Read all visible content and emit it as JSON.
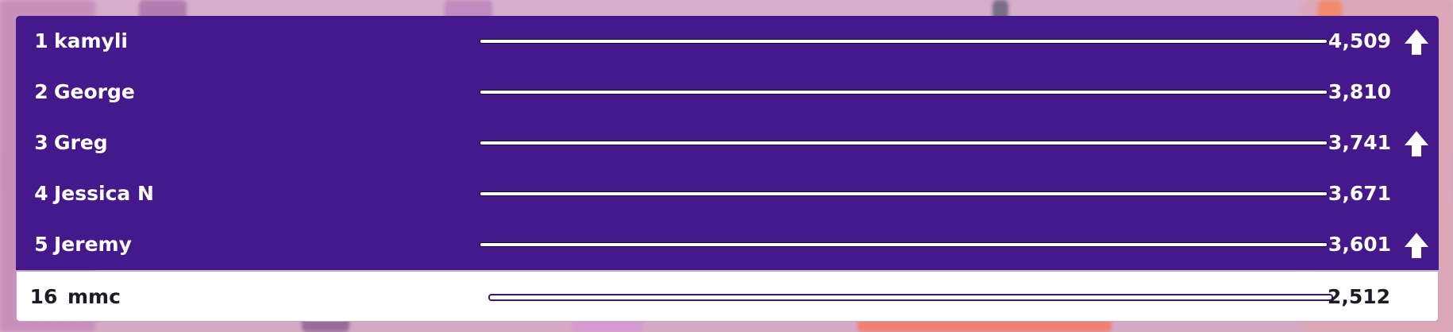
{
  "leaderboard": {
    "rows": [
      {
        "rank": "1",
        "name": "kamyli",
        "score": "4,509",
        "progress": 0.99,
        "trend": "up",
        "icon": "arrow-up-icon"
      },
      {
        "rank": "2",
        "name": "George",
        "score": "3,810",
        "progress": 1.0,
        "trend": "none"
      },
      {
        "rank": "3",
        "name": "Greg",
        "score": "3,741",
        "progress": 1.0,
        "trend": "up",
        "icon": "arrow-up-icon"
      },
      {
        "rank": "4",
        "name": "Jessica N",
        "score": "3,671",
        "progress": 1.0,
        "trend": "none"
      },
      {
        "rank": "5",
        "name": "Jeremy",
        "score": "3,601",
        "progress": 1.0,
        "trend": "up",
        "icon": "arrow-up-icon"
      }
    ],
    "self": {
      "rank": "16",
      "name": "mmc",
      "score": "2,512",
      "progress": 1.0,
      "trend": "none"
    }
  },
  "colors": {
    "row_background": "#45188c",
    "self_background": "#ffffff",
    "text_light": "#ffffff",
    "text_dark": "#1c1c24"
  }
}
